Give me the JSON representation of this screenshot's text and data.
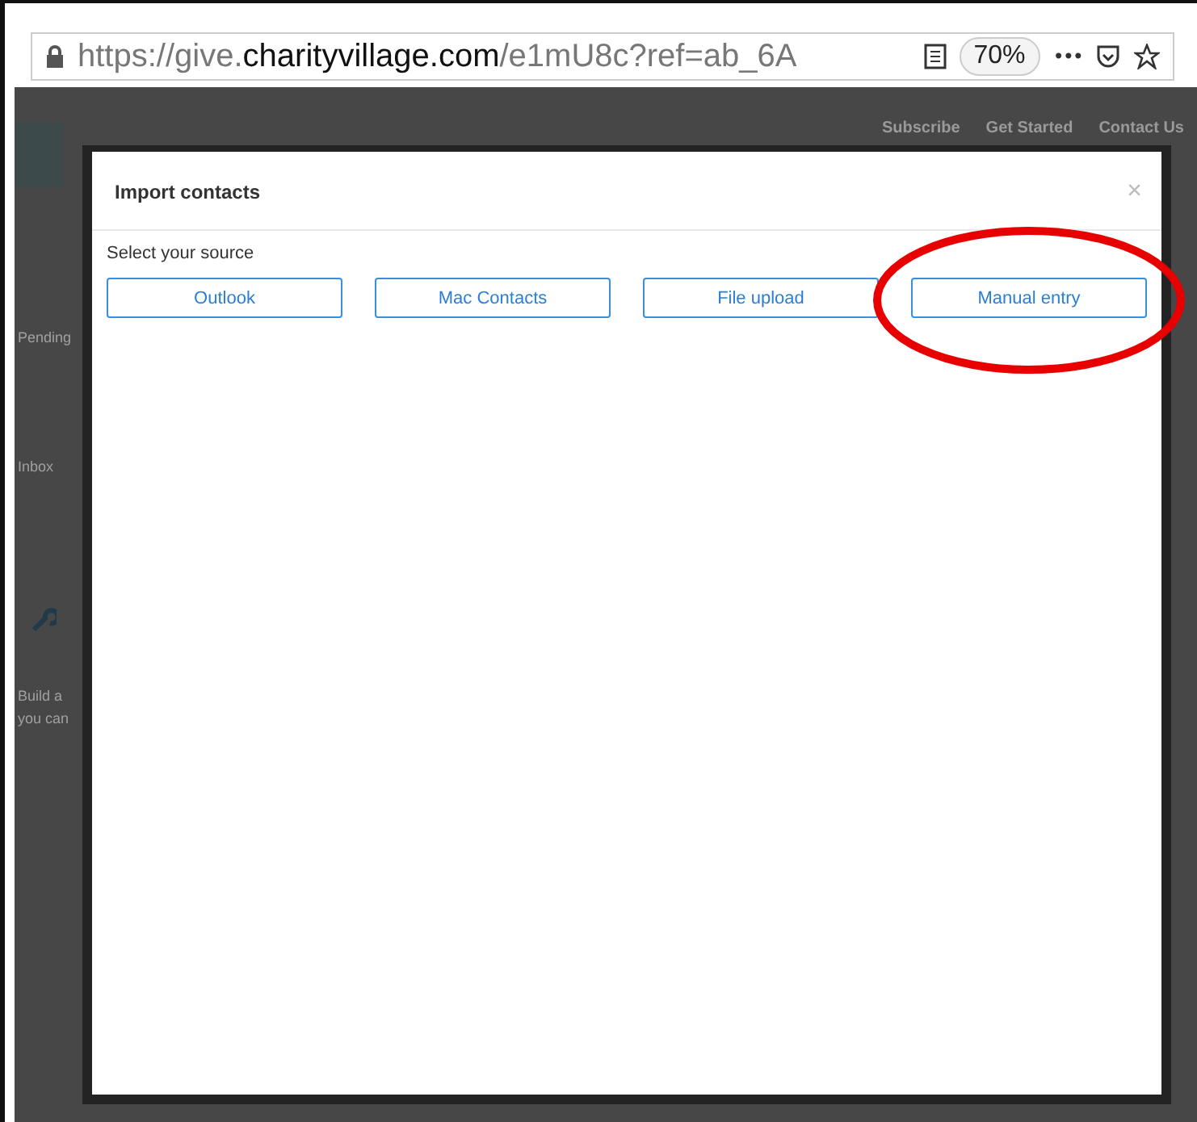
{
  "browser": {
    "url": {
      "scheme_host": "https://give.",
      "domain": "charityvillage.com",
      "path": "/e1mU8c?ref=ab_6A"
    },
    "zoom": "70%",
    "more": "•••"
  },
  "background_page": {
    "nav": [
      "Subscribe",
      "Get Started",
      "Contact Us"
    ],
    "status": "Pending",
    "tab": "Inbox",
    "text_lines": [
      "Build a",
      "you can"
    ]
  },
  "dialog": {
    "title": "Import contacts",
    "close": "×",
    "prompt": "Select your source",
    "sources": [
      {
        "label": "Outlook",
        "highlighted": false
      },
      {
        "label": "Mac Contacts",
        "highlighted": false
      },
      {
        "label": "File upload",
        "highlighted": false
      },
      {
        "label": "Manual entry",
        "highlighted": true
      }
    ]
  }
}
